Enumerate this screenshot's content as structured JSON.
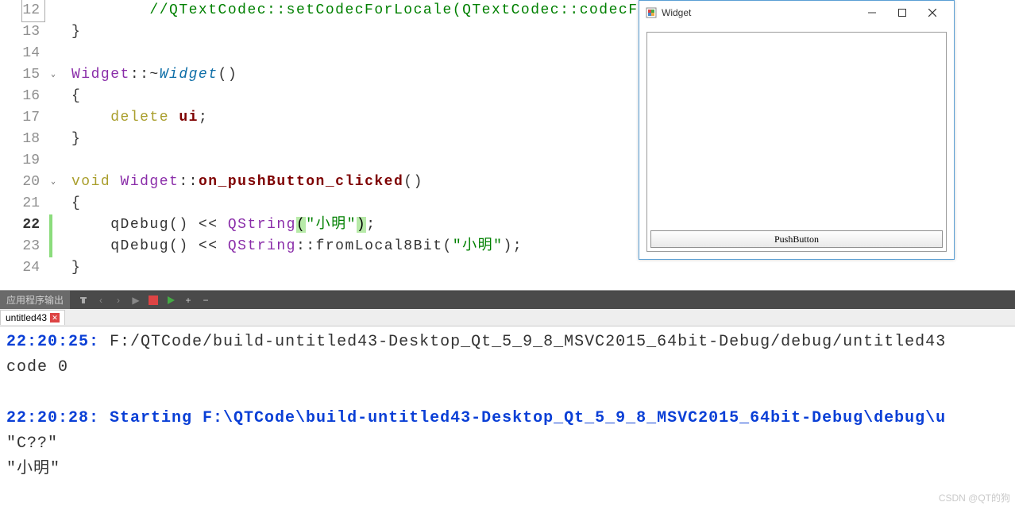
{
  "editor": {
    "lines": [
      {
        "num": "12",
        "boxed": true,
        "content": [
          {
            "t": "        ",
            "c": ""
          },
          {
            "t": "//QTextCodec::setCodecForLocale(QTextCodec::codecF",
            "c": "comment"
          }
        ]
      },
      {
        "num": "13",
        "content": [
          {
            "t": "}",
            "c": "punct"
          }
        ]
      },
      {
        "num": "14",
        "content": []
      },
      {
        "num": "15",
        "fold": true,
        "content": [
          {
            "t": "Widget",
            "c": "class"
          },
          {
            "t": "::~",
            "c": "punct"
          },
          {
            "t": "Widget",
            "c": "destr"
          },
          {
            "t": "()",
            "c": "punct"
          }
        ]
      },
      {
        "num": "16",
        "content": [
          {
            "t": "{",
            "c": "punct"
          }
        ]
      },
      {
        "num": "17",
        "content": [
          {
            "t": "    ",
            "c": ""
          },
          {
            "t": "delete ",
            "c": "kw"
          },
          {
            "t": "ui",
            "c": "member"
          },
          {
            "t": ";",
            "c": "punct"
          }
        ]
      },
      {
        "num": "18",
        "content": [
          {
            "t": "}",
            "c": "punct"
          }
        ]
      },
      {
        "num": "19",
        "content": []
      },
      {
        "num": "20",
        "fold": true,
        "content": [
          {
            "t": "void ",
            "c": "kw"
          },
          {
            "t": "Widget",
            "c": "class"
          },
          {
            "t": "::",
            "c": "punct"
          },
          {
            "t": "on_pushButton_clicked",
            "c": "method"
          },
          {
            "t": "()",
            "c": "punct"
          }
        ]
      },
      {
        "num": "21",
        "content": [
          {
            "t": "{",
            "c": "punct"
          }
        ]
      },
      {
        "num": "22",
        "bold": true,
        "mark": true,
        "content": [
          {
            "t": "    ",
            "c": ""
          },
          {
            "t": "qDebug",
            "c": "func"
          },
          {
            "t": "() << ",
            "c": "op"
          },
          {
            "t": "QString",
            "c": "class"
          },
          {
            "t": "(",
            "c": "highlight-paren"
          },
          {
            "t": "\"小明\"",
            "c": "str"
          },
          {
            "t": ")",
            "c": "highlight-paren"
          },
          {
            "t": ";",
            "c": "punct"
          }
        ]
      },
      {
        "num": "23",
        "mark": true,
        "content": [
          {
            "t": "    ",
            "c": ""
          },
          {
            "t": "qDebug",
            "c": "func"
          },
          {
            "t": "() << ",
            "c": "op"
          },
          {
            "t": "QString",
            "c": "class"
          },
          {
            "t": "::",
            "c": "punct"
          },
          {
            "t": "fromLocal8Bit",
            "c": "func"
          },
          {
            "t": "(",
            "c": "punct"
          },
          {
            "t": "\"小明\"",
            "c": "str"
          },
          {
            "t": ")",
            "c": "punct"
          },
          {
            "t": ";",
            "c": "punct"
          }
        ]
      },
      {
        "num": "24",
        "content": [
          {
            "t": "}",
            "c": "punct"
          }
        ]
      }
    ]
  },
  "output": {
    "panel_title": "应用程序输出",
    "tab": "untitled43",
    "lines": [
      {
        "spans": [
          {
            "t": "22:20:25: ",
            "c": "out-blue"
          },
          {
            "t": "F:/QTCode/build-untitled43-Desktop_Qt_5_9_8_MSVC2015_64bit-Debug/debug/untitled43",
            "c": "out-gray"
          }
        ]
      },
      {
        "spans": [
          {
            "t": "code 0",
            "c": "out-gray"
          }
        ]
      },
      {
        "spans": [
          {
            "t": "",
            "c": ""
          }
        ]
      },
      {
        "spans": [
          {
            "t": "22:20:28: Starting F:\\QTCode\\build-untitled43-Desktop_Qt_5_9_8_MSVC2015_64bit-Debug\\debug\\u",
            "c": "out-blue"
          }
        ]
      },
      {
        "spans": [
          {
            "t": "\"C??\"",
            "c": "out-gray"
          }
        ]
      },
      {
        "spans": [
          {
            "t": "\"小明\"",
            "c": "out-gray"
          }
        ]
      }
    ]
  },
  "widget_window": {
    "title": "Widget",
    "button": "PushButton"
  },
  "watermark": "CSDN @QT的狗"
}
